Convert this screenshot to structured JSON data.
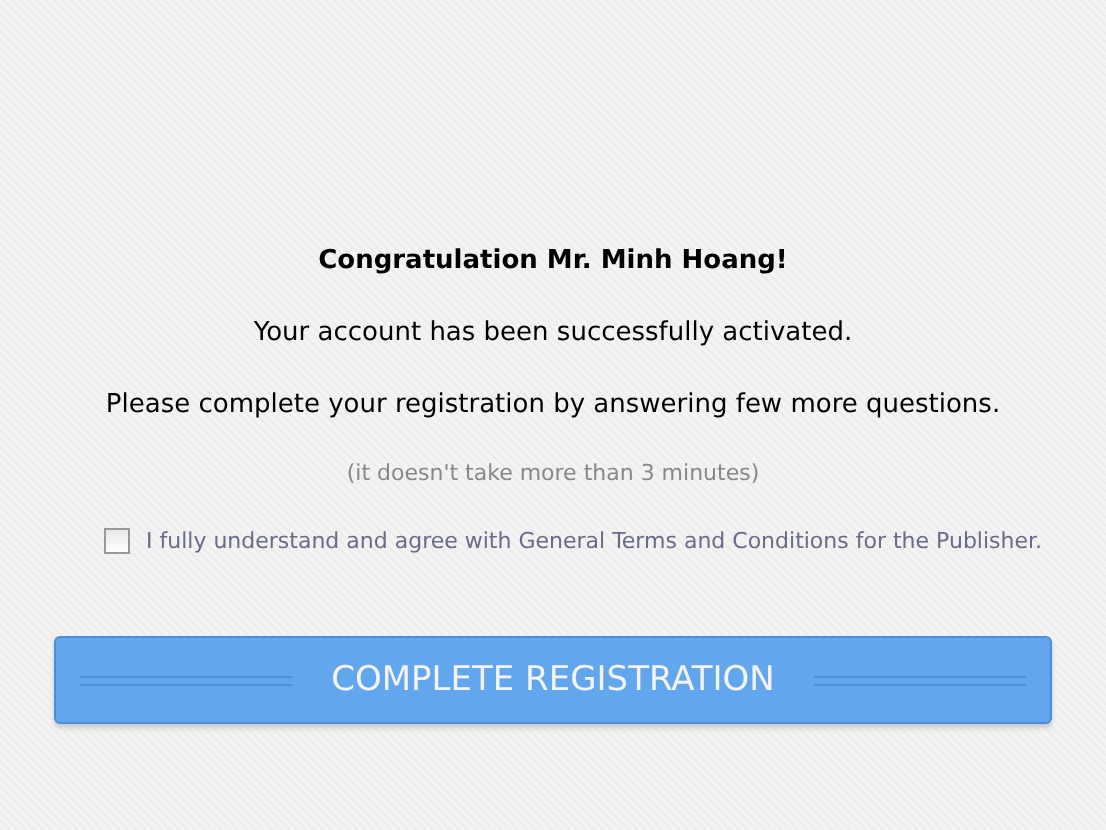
{
  "heading": "Congratulation Mr. Minh Hoang!",
  "message": "Your account has been successfully activated.",
  "instruction": "Please complete your registration by answering few more questions.",
  "note": "(it doesn't take more than 3 minutes)",
  "agreement": {
    "label": "I fully understand and agree with General Terms and Conditions for the Publisher.",
    "checked": false
  },
  "button": "COMPLETE REGISTRATION"
}
